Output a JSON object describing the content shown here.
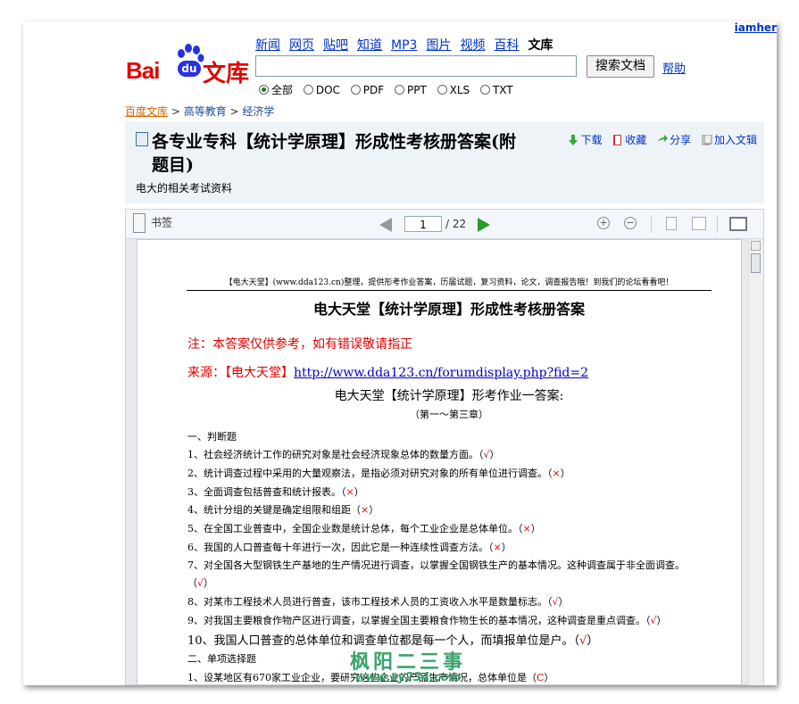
{
  "user": "iamher",
  "nav": {
    "items": [
      "新闻",
      "网页",
      "贴吧",
      "知道",
      "MP3",
      "图片",
      "视频",
      "百科"
    ],
    "active": "文库"
  },
  "logo": {
    "bai": "Bai",
    "du": "du",
    "wenku": "文库"
  },
  "search": {
    "value": "",
    "button": "搜索文档",
    "help": "帮助"
  },
  "filters": {
    "selected": "全部",
    "options": [
      "全部",
      "DOC",
      "PDF",
      "PPT",
      "XLS",
      "TXT"
    ]
  },
  "breadcrumb": [
    "百度文库",
    "高等教育",
    "经济学"
  ],
  "doc": {
    "title": "各专业专科【统计学原理】形成性考核册答案(附题目)",
    "description": "电大的相关考试资料",
    "actions": [
      "下载",
      "收藏",
      "分享",
      "加入文辑"
    ]
  },
  "viewer": {
    "bookmark": "书签",
    "page": "1",
    "total": "/ 22"
  },
  "content": {
    "header": "【电大天堂】(www.dda123.cn)整理，提供形考作业答案，历届试题，复习资料，论文，调查报告哦！到我们的论坛看看吧！",
    "title": "电大天堂【统计学原理】形成性考核册答案",
    "note": "注：本答案仅供参考，如有错误敬请指正",
    "source_label": "来源：【电大天堂】",
    "source_url": "http://www.dda123.cn/forumdisplay.php?fid=2",
    "subtitle": "电大天堂【统计学原理】形考作业一答案:",
    "chapter": "（第一～第三章）",
    "lines": [
      {
        "text": "一、判断题",
        "mark": ""
      },
      {
        "text": "1、社会经济统计工作的研究对象是社会经济现象总体的数量方面。（",
        "mark": "√",
        "end": "）"
      },
      {
        "text": "2、统计调查过程中采用的大量观察法，是指必须对研究对象的所有单位进行调查。（",
        "mark": "×",
        "end": "）"
      },
      {
        "text": "3、全面调查包括普查和统计报表。（",
        "mark": "×",
        "end": "）"
      },
      {
        "text": "4、统计分组的关键是确定组限和组距（",
        "mark": "×",
        "end": "）"
      },
      {
        "text": "5、在全国工业普查中，全国企业数是统计总体，每个工业企业是总体单位。（",
        "mark": "×",
        "end": "）"
      },
      {
        "text": "6、我国的人口普查每十年进行一次，因此它是一种连续性调查方法。（",
        "mark": "×",
        "end": "）"
      },
      {
        "text": "7、对全国各大型钢铁生产基地的生产情况进行调查，以掌握全国钢铁生产的基本情况。这种调查属于非全面调查。",
        "mark": "",
        "end": ""
      },
      {
        "text": "（",
        "mark": "√",
        "end": "）"
      },
      {
        "text": "8、对某市工程技术人员进行普查，该市工程技术人员的工资收入水平是数量标志。（",
        "mark": "√",
        "end": "）"
      },
      {
        "text": "9、对我国主要粮食作物产区进行调查，以掌握全国主要粮食作物生长的基本情况，这种调查是重点调查。（",
        "mark": "√",
        "end": "）"
      },
      {
        "text": "10、我国人口普查的总体单位和调查单位都是每一个人，而填报单位是户。（",
        "mark": "√",
        "end": "）"
      },
      {
        "text": "二、单项选择题",
        "mark": ""
      },
      {
        "text": "1、设某地区有670家工业企业，要研究这些企业的产品生产情况，总体单位是（",
        "mark": "C",
        "end": "）"
      }
    ]
  },
  "watermark": {
    "line1": "枫阳二三事",
    "line2": "www.zy234.com"
  }
}
